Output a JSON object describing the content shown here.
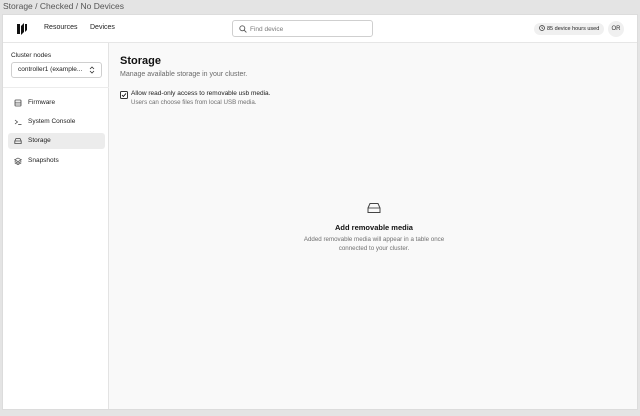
{
  "window": {
    "breadcrumb": "Storage / Checked / No Devices"
  },
  "topbar": {
    "nav": [
      {
        "label": "Resources"
      },
      {
        "label": "Devices"
      }
    ],
    "search": {
      "placeholder": "Find device",
      "value": ""
    },
    "usage": "85 device hours used",
    "avatar_initials": "OR"
  },
  "sidebar": {
    "heading": "Cluster nodes",
    "node_select": "controller1 (example...",
    "items": [
      {
        "label": "Firmware",
        "icon": "chip-icon",
        "active": false
      },
      {
        "label": "System Console",
        "icon": "terminal-icon",
        "active": false
      },
      {
        "label": "Storage",
        "icon": "storage-icon",
        "active": true
      },
      {
        "label": "Snapshots",
        "icon": "layers-icon",
        "active": false
      }
    ]
  },
  "main": {
    "title": "Storage",
    "subtitle": "Manage available storage in your cluster.",
    "option": {
      "checked": true,
      "label": "Allow read-only access to removable usb media.",
      "help": "Users can choose files from local USB media."
    },
    "empty": {
      "icon": "storage-icon",
      "title": "Add removable media",
      "description": "Added removable media will appear in a table once connected to your cluster."
    }
  }
}
